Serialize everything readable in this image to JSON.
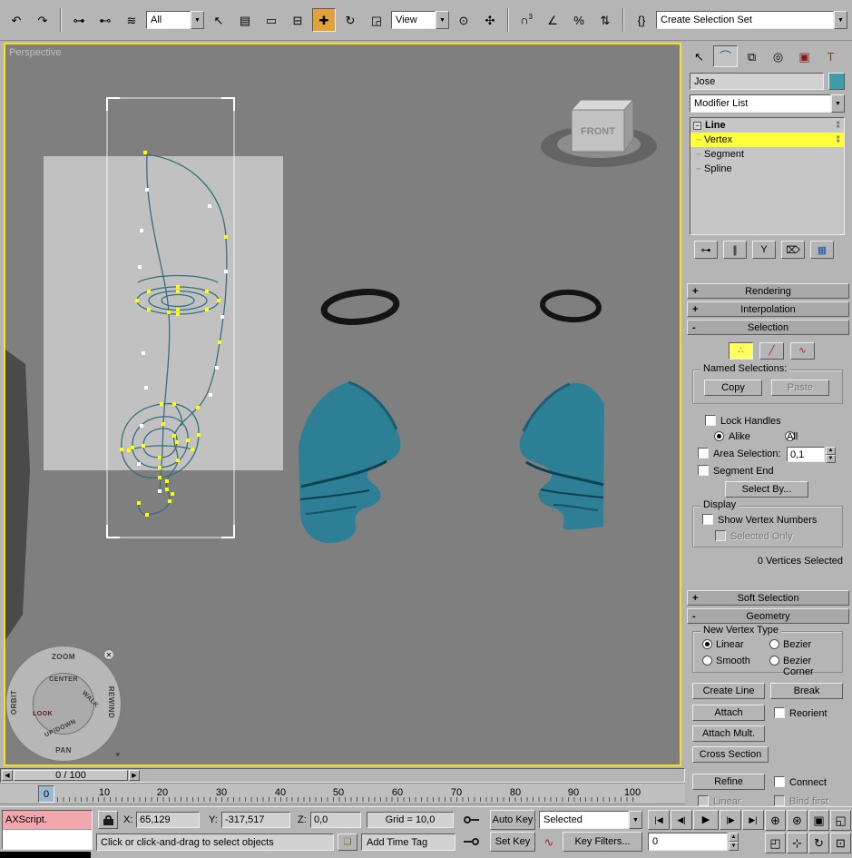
{
  "toolbar": {
    "filter_value": "All",
    "coord_value": "View",
    "selection_set_value": "Create Selection Set"
  },
  "viewport": {
    "label": "Perspective",
    "front_label": "FRONT"
  },
  "wheel": {
    "zoom": "ZOOM",
    "center": "CENTER",
    "walk": "WALK",
    "rewind": "REWIND",
    "orbit": "ORBIT",
    "look": "LOOK",
    "up_down": "UP/DOWN",
    "pan": "PAN"
  },
  "panel": {
    "object_name": "Jose",
    "modifier_list": "Modifier List",
    "stack": {
      "line": "Line",
      "vertex": "Vertex",
      "segment": "Segment",
      "spline": "Spline"
    },
    "rollouts": {
      "rendering": {
        "sign": "+",
        "label": "Rendering"
      },
      "interpolation": {
        "sign": "+",
        "label": "Interpolation"
      },
      "selection": {
        "sign": "-",
        "label": "Selection"
      },
      "soft_selection": {
        "sign": "+",
        "label": "Soft Selection"
      },
      "geometry": {
        "sign": "-",
        "label": "Geometry"
      }
    },
    "selection": {
      "named_selections": "Named Selections:",
      "copy": "Copy",
      "paste": "Paste",
      "lock_handles": "Lock Handles",
      "alike": "Alike",
      "all": "All",
      "area_selection": "Area Selection:",
      "area_value": "0,1",
      "segment_end": "Segment End",
      "select_by": "Select By...",
      "display": "Display",
      "show_vertex_numbers": "Show Vertex Numbers",
      "selected_only": "Selected Only",
      "status": "0 Vertices Selected"
    },
    "geometry": {
      "new_vertex_type": "New Vertex Type",
      "linear": "Linear",
      "bezier": "Bezier",
      "smooth": "Smooth",
      "bezier_corner": "Bezier Corner",
      "create_line": "Create Line",
      "break_btn": "Break",
      "attach": "Attach",
      "reorient": "Reorient",
      "attach_mult": "Attach Mult.",
      "cross_section": "Cross Section",
      "refine": "Refine",
      "connect": "Connect",
      "linear2": "Linear",
      "bind_first": "Bind first"
    }
  },
  "timeline": {
    "slider": "0 / 100",
    "current": "0",
    "ticks": [
      "10",
      "20",
      "30",
      "40",
      "50",
      "60",
      "70",
      "80",
      "90",
      "100"
    ]
  },
  "status": {
    "maxscript": "AXScript.",
    "x_label": "X:",
    "x": "65,129",
    "y_label": "Y:",
    "y": "-317,517",
    "z_label": "Z:",
    "z": "0,0",
    "grid": "Grid = 10,0",
    "prompt": "Click or click-and-drag to select objects",
    "add_time_tag": "Add Time Tag",
    "auto_key": "Auto Key",
    "set_key": "Set Key",
    "selected": "Selected",
    "key_filters": "Key Filters...",
    "frame": "0"
  }
}
